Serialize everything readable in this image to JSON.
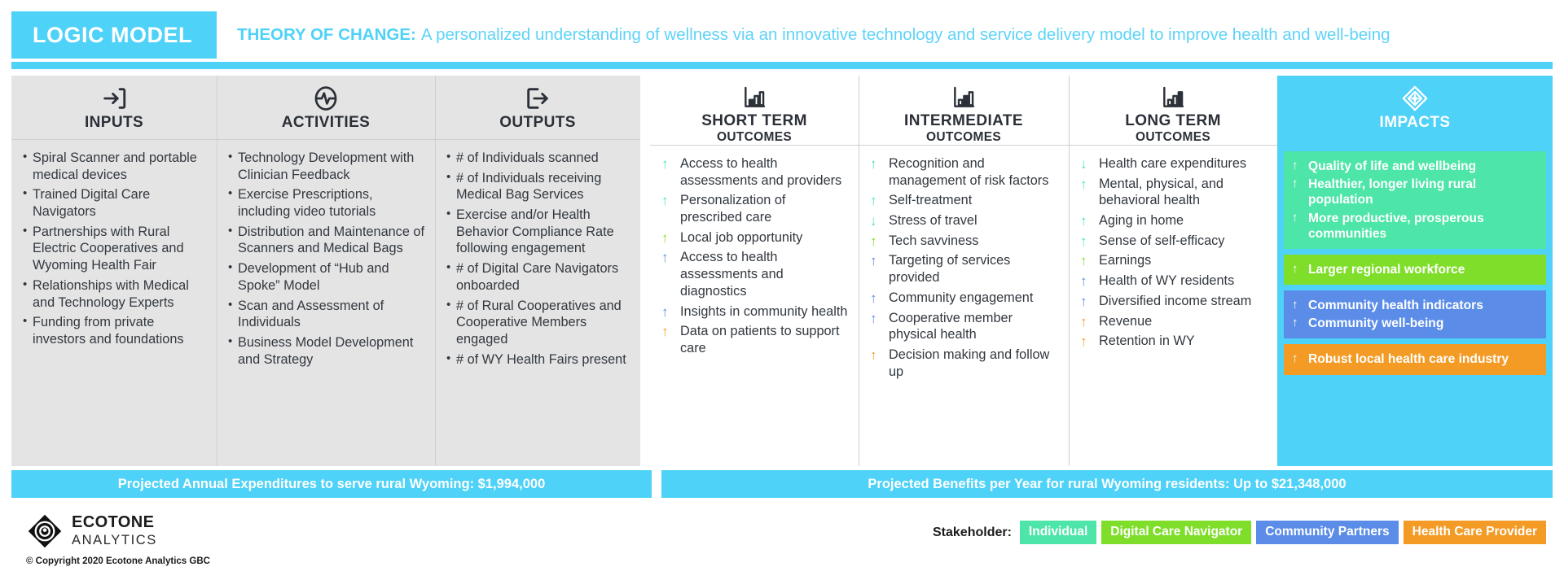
{
  "title": {
    "badge": "LOGIC MODEL",
    "theory_label": "THEORY OF CHANGE:",
    "theory_text": "A personalized understanding of wellness via an innovative technology and service delivery model to improve health and well-being"
  },
  "colors": {
    "cyan": "#4ed2f7",
    "individual": "#4ee5a8",
    "digital_care_navigator": "#7ede2a",
    "community_partners": "#5b8de8",
    "health_care_provider": "#f49b25",
    "gray_column": "#e4e4e4"
  },
  "columns": [
    {
      "id": "inputs",
      "title": "INPUTS",
      "subtitle": "",
      "icon": "sign-in-arrow-icon",
      "items": [
        "Spiral Scanner and portable medical devices",
        "Trained Digital Care Navigators",
        "Partnerships with Rural Electric Cooperatives and Wyoming Health Fair",
        "Relationships with Medical and Technology Experts",
        "Funding from private investors and foundations"
      ]
    },
    {
      "id": "activities",
      "title": "ACTIVITIES",
      "subtitle": "",
      "icon": "activity-pulse-icon",
      "items": [
        "Technology Development with Clinician Feedback",
        "Exercise Prescriptions, including video tutorials",
        "Distribution and Maintenance of Scanners and Medical Bags",
        "Development of “Hub and Spoke” Model",
        "Scan and Assessment of Individuals",
        "Business Model Development and Strategy"
      ]
    },
    {
      "id": "outputs",
      "title": "OUTPUTS",
      "subtitle": "",
      "icon": "sign-out-arrow-icon",
      "items": [
        "# of Individuals scanned",
        "# of Individuals receiving Medical Bag Services",
        "Exercise and/or Health Behavior Compliance Rate following engagement",
        "# of Digital Care Navigators onboarded",
        "# of Rural Cooperatives and Cooperative Members engaged",
        "# of WY Health Fairs present"
      ]
    },
    {
      "id": "short-term-outcomes",
      "title": "SHORT TERM",
      "subtitle": "OUTCOMES",
      "icon": "bar-chart-icon",
      "outcomes": [
        {
          "text": "Access to health assessments and providers",
          "direction": "up",
          "stakeholder": "individual"
        },
        {
          "text": "Personalization of prescribed care",
          "direction": "up",
          "stakeholder": "individual"
        },
        {
          "text": "Local job opportunity",
          "direction": "up",
          "stakeholder": "digital_care_navigator"
        },
        {
          "text": "Access to health assessments and diagnostics",
          "direction": "up",
          "stakeholder": "community_partners"
        },
        {
          "text": "Insights in community health",
          "direction": "up",
          "stakeholder": "community_partners"
        },
        {
          "text": "Data on patients to support care",
          "direction": "up",
          "stakeholder": "health_care_provider"
        }
      ]
    },
    {
      "id": "intermediate-outcomes",
      "title": "INTERMEDIATE",
      "subtitle": "OUTCOMES",
      "icon": "bar-chart-icon",
      "outcomes": [
        {
          "text": "Recognition and management of risk factors",
          "direction": "up",
          "stakeholder": "individual"
        },
        {
          "text": "Self-treatment",
          "direction": "up",
          "stakeholder": "individual"
        },
        {
          "text": "Stress of travel",
          "direction": "down",
          "stakeholder": "individual"
        },
        {
          "text": "Tech savviness",
          "direction": "up",
          "stakeholder": "digital_care_navigator"
        },
        {
          "text": "Targeting of services provided",
          "direction": "up",
          "stakeholder": "community_partners"
        },
        {
          "text": "Community engagement",
          "direction": "up",
          "stakeholder": "community_partners"
        },
        {
          "text": "Cooperative member physical health",
          "direction": "up",
          "stakeholder": "community_partners"
        },
        {
          "text": "Decision making and follow up",
          "direction": "up",
          "stakeholder": "health_care_provider"
        }
      ]
    },
    {
      "id": "long-term-outcomes",
      "title": "LONG TERM",
      "subtitle": "OUTCOMES",
      "icon": "bar-chart-icon",
      "outcomes": [
        {
          "text": "Health care expenditures",
          "direction": "down",
          "stakeholder": "individual"
        },
        {
          "text": "Mental, physical, and behavioral health",
          "direction": "up",
          "stakeholder": "individual"
        },
        {
          "text": "Aging in home",
          "direction": "up",
          "stakeholder": "individual"
        },
        {
          "text": "Sense of self-efficacy",
          "direction": "up",
          "stakeholder": "individual"
        },
        {
          "text": "Earnings",
          "direction": "up",
          "stakeholder": "digital_care_navigator"
        },
        {
          "text": "Health of WY residents",
          "direction": "up",
          "stakeholder": "community_partners"
        },
        {
          "text": "Diversified income stream",
          "direction": "up",
          "stakeholder": "community_partners"
        },
        {
          "text": "Revenue",
          "direction": "up",
          "stakeholder": "health_care_provider"
        },
        {
          "text": "Retention in WY",
          "direction": "up",
          "stakeholder": "health_care_provider"
        }
      ]
    },
    {
      "id": "impacts",
      "title": "IMPACTS",
      "subtitle": "",
      "icon": "diamond-gem-icon",
      "blocks": [
        {
          "stakeholder": "individual",
          "items": [
            {
              "text": "Quality of life and wellbeing",
              "direction": "up"
            },
            {
              "text": "Healthier, longer living rural population",
              "direction": "up"
            },
            {
              "text": "More productive, prosperous communities",
              "direction": "up"
            }
          ]
        },
        {
          "stakeholder": "digital_care_navigator",
          "items": [
            {
              "text": "Larger regional workforce",
              "direction": "up"
            }
          ]
        },
        {
          "stakeholder": "community_partners",
          "items": [
            {
              "text": "Community health indicators",
              "direction": "up"
            },
            {
              "text": "Community well-being",
              "direction": "up"
            }
          ]
        },
        {
          "stakeholder": "health_care_provider",
          "items": [
            {
              "text": "Robust local health care industry",
              "direction": "up"
            }
          ]
        }
      ]
    }
  ],
  "money": {
    "left": "Projected Annual Expenditures to serve rural Wyoming: $1,994,000",
    "right": "Projected Benefits per Year for rural Wyoming residents: Up to $21,348,000"
  },
  "footer": {
    "brand_name": "ECOTONE",
    "brand_sub": "ANALYTICS",
    "copyright": "© Copyright 2020 Ecotone Analytics GBC",
    "legend_label": "Stakeholder:",
    "legend": [
      {
        "label": "Individual",
        "key": "individual"
      },
      {
        "label": "Digital Care Navigator",
        "key": "digital_care_navigator"
      },
      {
        "label": "Community Partners",
        "key": "community_partners"
      },
      {
        "label": "Health Care Provider",
        "key": "health_care_provider"
      }
    ]
  }
}
